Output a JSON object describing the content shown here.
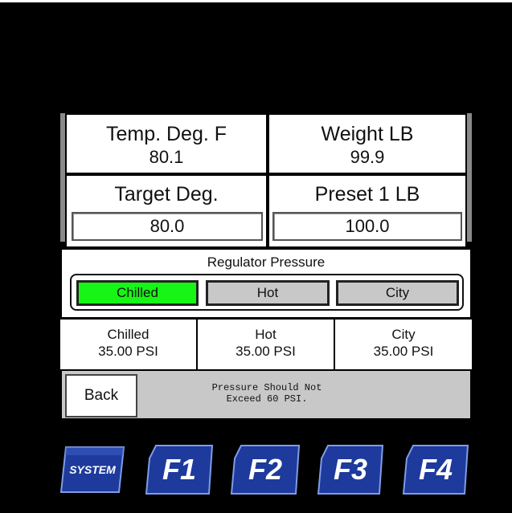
{
  "tiles": {
    "temp_label": "Temp. Deg. F",
    "temp_value": "80.1",
    "weight_label": "Weight LB",
    "weight_value": "99.9",
    "target_label": "Target Deg.",
    "target_value": "80.0",
    "preset_label": "Preset 1 LB",
    "preset_value": "100.0"
  },
  "regulator": {
    "title": "Regulator Pressure",
    "modes": [
      "Chilled",
      "Hot",
      "City"
    ],
    "selected": "Chilled"
  },
  "pressures": [
    {
      "name": "Chilled",
      "value": "35.00 PSI"
    },
    {
      "name": "Hot",
      "value": "35.00 PSI"
    },
    {
      "name": "City",
      "value": "35.00 PSI"
    }
  ],
  "footer": {
    "back_label": "Back",
    "warning_line1": "Pressure Should Not",
    "warning_line2": "Exceed 60 PSI."
  },
  "function_keys": [
    "SYSTEM",
    "F1",
    "F2",
    "F3",
    "F4"
  ],
  "colors": {
    "active_mode": "#17f517",
    "key_blue": "#1d3a9c"
  }
}
